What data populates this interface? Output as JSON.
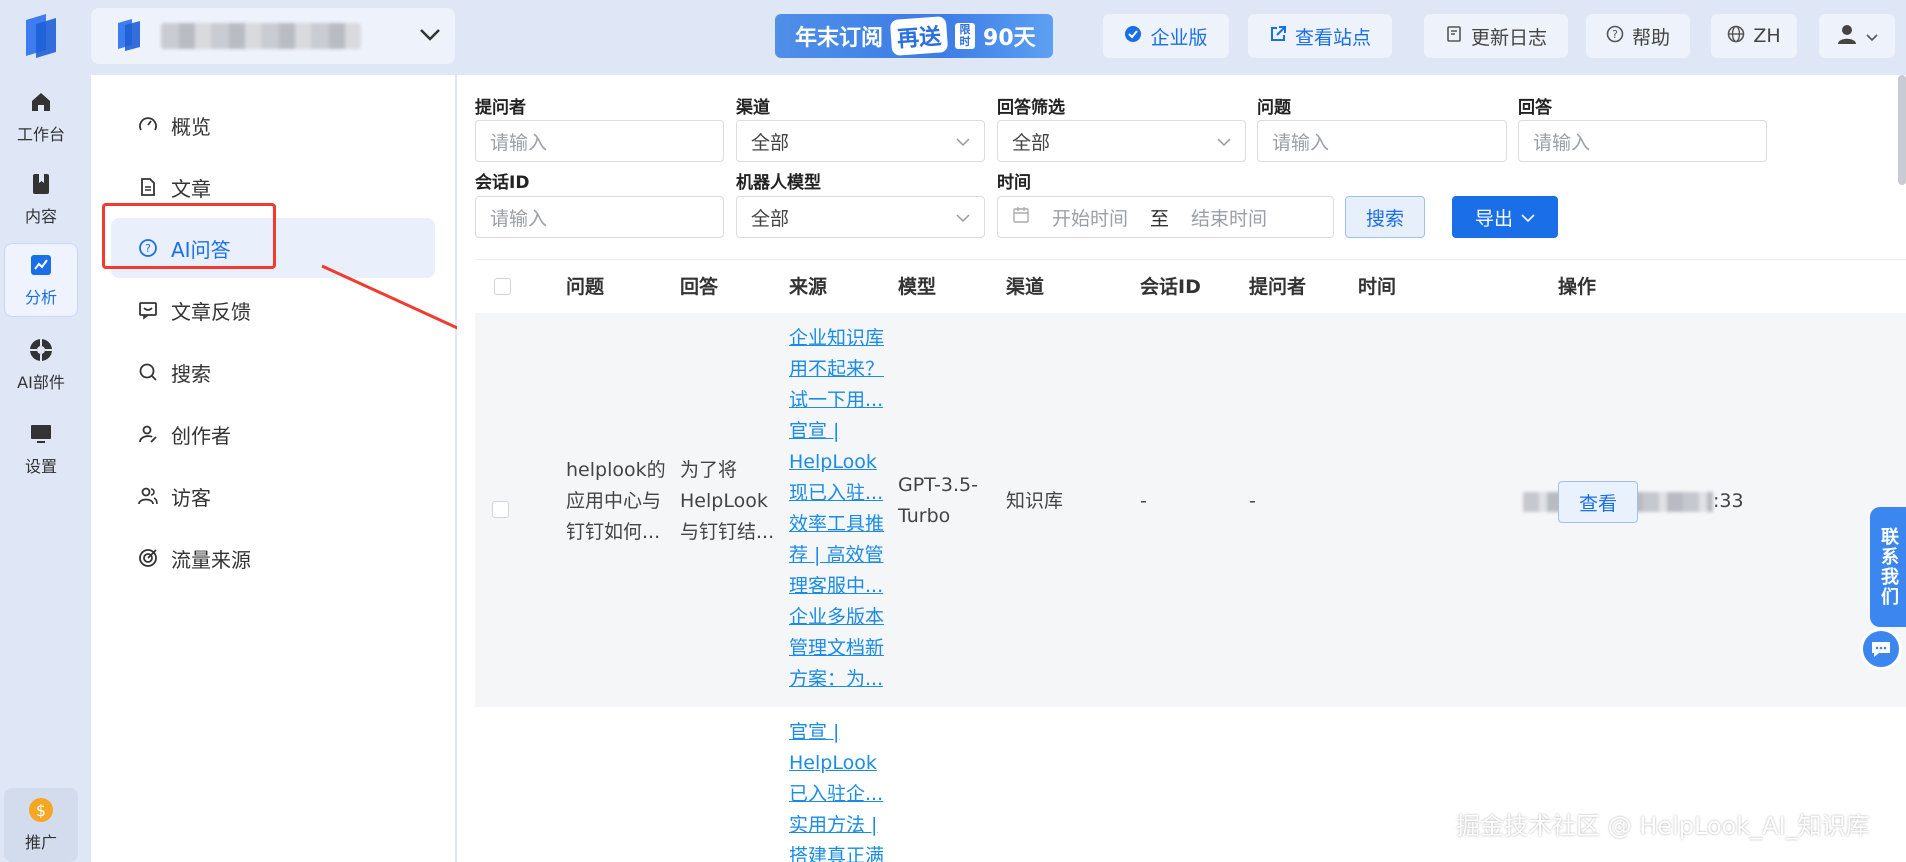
{
  "rail": {
    "items": [
      {
        "label": "工作台",
        "icon": "home-icon"
      },
      {
        "label": "内容",
        "icon": "book-icon"
      },
      {
        "label": "分析",
        "icon": "chart-icon",
        "active": true
      },
      {
        "label": "AI部件",
        "icon": "ai-widget-icon"
      },
      {
        "label": "设置",
        "icon": "monitor-icon"
      }
    ],
    "promo_label": "推广"
  },
  "topbar": {
    "promo_text_1": "年末订阅",
    "promo_text_2": "再送",
    "promo_limit": "限时",
    "promo_text_3": "90天",
    "enterprise_label": "企业版",
    "view_site_label": "查看站点",
    "changelog_label": "更新日志",
    "help_label": "帮助",
    "lang_label": "ZH"
  },
  "subnav": {
    "items": [
      {
        "label": "概览"
      },
      {
        "label": "文章"
      },
      {
        "label": "AI问答"
      },
      {
        "label": "文章反馈"
      },
      {
        "label": "搜索"
      },
      {
        "label": "创作者"
      },
      {
        "label": "访客"
      },
      {
        "label": "流量来源"
      }
    ]
  },
  "filters": {
    "asker_label": "提问者",
    "asker_placeholder": "请输入",
    "channel_label": "渠道",
    "channel_value": "全部",
    "answer_filter_label": "回答筛选",
    "answer_filter_value": "全部",
    "question_label": "问题",
    "question_placeholder": "请输入",
    "answer_label": "回答",
    "answer_placeholder": "请输入",
    "session_label": "会话ID",
    "session_placeholder": "请输入",
    "model_label": "机器人模型",
    "model_value": "全部",
    "time_label": "时间",
    "start_placeholder": "开始时间",
    "range_sep": "至",
    "end_placeholder": "结束时间",
    "search_button": "搜索",
    "export_button": "导出"
  },
  "table": {
    "headers": [
      "问题",
      "回答",
      "来源",
      "模型",
      "渠道",
      "会话ID",
      "提问者",
      "时间",
      "操作"
    ],
    "rows": [
      {
        "question": [
          "helplook的",
          "应用中心与",
          "钉钉如何..."
        ],
        "answer": [
          "为了将",
          "HelpLook",
          "与钉钉结..."
        ],
        "sources": [
          "企业知识库",
          "用不起来？",
          "试一下用...",
          "官宣 |",
          "HelpLook",
          "现已入驻...",
          "效率工具推",
          "荐 | 高效管",
          "理客服中...",
          "企业多版本",
          "管理文档新",
          "方案：为..."
        ],
        "model": [
          "GPT-3.5-",
          "Turbo"
        ],
        "channel": "知识库",
        "session": "-",
        "asker": "-",
        "time_suffix": ":33",
        "action": "查看"
      },
      {
        "sources": [
          "官宣 |",
          "HelpLook",
          "已入驻企...",
          "实用方法 |",
          "搭建真正满"
        ]
      }
    ]
  },
  "contact_label": "联系我们",
  "watermark": "掘金技术社区 @ HelpLook_AI_知识库"
}
